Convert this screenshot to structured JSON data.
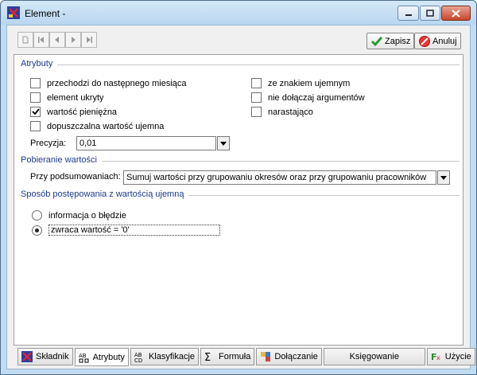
{
  "window": {
    "title": "Element -"
  },
  "toolbar": {
    "save_label": "Zapisz",
    "cancel_label": "Anuluj"
  },
  "atrybuty": {
    "title": "Atrybuty",
    "left": [
      {
        "label": "przechodzi do następnego miesiąca",
        "checked": false
      },
      {
        "label": "element ukryty",
        "checked": false
      },
      {
        "label": "wartość pieniężna",
        "checked": true
      },
      {
        "label": "dopuszczalna wartość ujemna",
        "checked": false
      }
    ],
    "right": [
      {
        "label": "ze znakiem ujemnym",
        "checked": false
      },
      {
        "label": "nie dołączaj argumentów",
        "checked": false
      },
      {
        "label": "narastająco",
        "checked": false
      }
    ],
    "precision_label": "Precyzja:",
    "precision_value": "0,01"
  },
  "pobieranie": {
    "title": "Pobieranie wartości",
    "summary_label": "Przy podsumowaniach:",
    "summary_value": "Sumuj wartości przy grupowaniu okresów oraz przy grupowaniu pracowników"
  },
  "sposob": {
    "title": "Sposób postępowania z wartością ujemną",
    "options": [
      {
        "label": "informacja o błędzie",
        "selected": false
      },
      {
        "label": "zwraca wartość = '0'",
        "selected": true
      }
    ]
  },
  "tabs": [
    {
      "label": "Składnik",
      "icon": "component-icon"
    },
    {
      "label": "Atrybuty",
      "icon": "attributes-icon",
      "active": true
    },
    {
      "label": "Klasyfikacje",
      "icon": "classification-icon"
    },
    {
      "label": "Formuła",
      "icon": "sigma-icon"
    },
    {
      "label": "Dołączanie",
      "icon": "attach-icon"
    },
    {
      "label": "Księgowanie",
      "icon": ""
    },
    {
      "label": "Użycie",
      "icon": "fx-icon"
    }
  ],
  "colors": {
    "section_title": "#1a3a8a",
    "accent": "#bfdcf3"
  }
}
